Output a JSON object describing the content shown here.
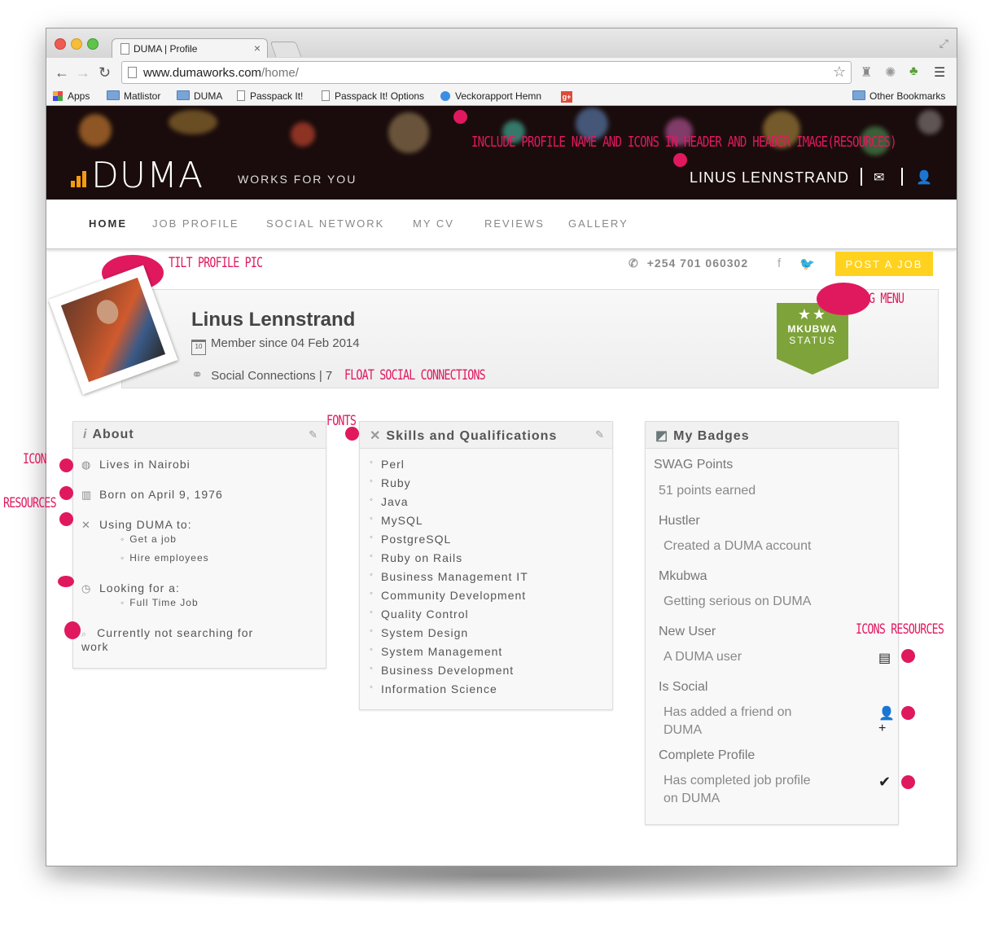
{
  "browser": {
    "tab_title": "DUMA | Profile",
    "url_host": "www.dumaworks.com",
    "url_path": "/home/",
    "bookmarks": [
      "Apps",
      "Matlistor",
      "DUMA",
      "Passpack It!",
      "Passpack It! Options",
      "Veckorapport Hemn",
      "Other Bookmarks"
    ]
  },
  "header": {
    "logo_text": "DUMA",
    "tagline": "WORKS FOR YOU",
    "user_name": "LINUS LENNSTRAND"
  },
  "nav": {
    "items": [
      "HOME",
      "JOB  PROFILE",
      "SOCIAL  NETWORK",
      "MY  CV",
      "REVIEWS",
      "GALLERY"
    ],
    "active": "HOME"
  },
  "contact": {
    "phone": "+254 701 060302",
    "post_job": "POST A JOB"
  },
  "profile": {
    "name": "Linus Lennstrand",
    "member_since": "Member since 04 Feb 2014",
    "social_connections": "Social Connections | 7",
    "cal_day": "10",
    "status_stars": "★★",
    "status_line1": "MKUBWA",
    "status_line2": "STATUS"
  },
  "about": {
    "title": "About",
    "lives": "Lives in Nairobi",
    "born": "Born on April 9, 1976",
    "using": "Using DUMA to:",
    "using_items": [
      "Get a job",
      "Hire employees"
    ],
    "looking": "Looking for a:",
    "looking_items": [
      "Full Time Job"
    ],
    "searching_1": "Currently not searching for",
    "searching_2": "work"
  },
  "skills": {
    "title": "Skills and Qualifications",
    "items": [
      "Perl",
      "Ruby",
      "Java",
      "MySQL",
      "PostgreSQL",
      "Ruby on Rails",
      "Business Management IT",
      "Community Development",
      "Quality Control",
      "System Design",
      "System Management",
      "Business Development",
      "Information Science"
    ]
  },
  "badges": {
    "title": "My Badges",
    "swag_label": "SWAG Points",
    "swag_value": "51 points earned",
    "items": [
      {
        "name": "Hustler",
        "desc": "Created a DUMA account"
      },
      {
        "name": "Mkubwa",
        "desc": "Getting serious on DUMA"
      },
      {
        "name": "New User",
        "desc": "A DUMA user"
      },
      {
        "name": "Is Social",
        "desc": "Has added a friend on",
        "desc2": "DUMA"
      },
      {
        "name": "Complete Profile",
        "desc": "Has completed job profile",
        "desc2": "on DUMA"
      }
    ]
  },
  "annotations": {
    "header_note": "INCLUDE PROFILE NAME AND ICONS IN HEADER AND HEADER IMAGE(RESOURCES)",
    "tilt": "TILT PROFILE PIC",
    "rating": "RATING MENU",
    "float_social": "FLOAT SOCIAL CONNECTIONS",
    "fonts": "FONTS",
    "icon": "ICON",
    "resources": "RESOURCES",
    "icons_resources": "ICONS RESOURCES"
  },
  "colors": {
    "accent_pink": "#e0195f",
    "brand_orange": "#f39c12",
    "status_green": "#7ea33a",
    "post_job_yellow": "#ffd21f"
  }
}
